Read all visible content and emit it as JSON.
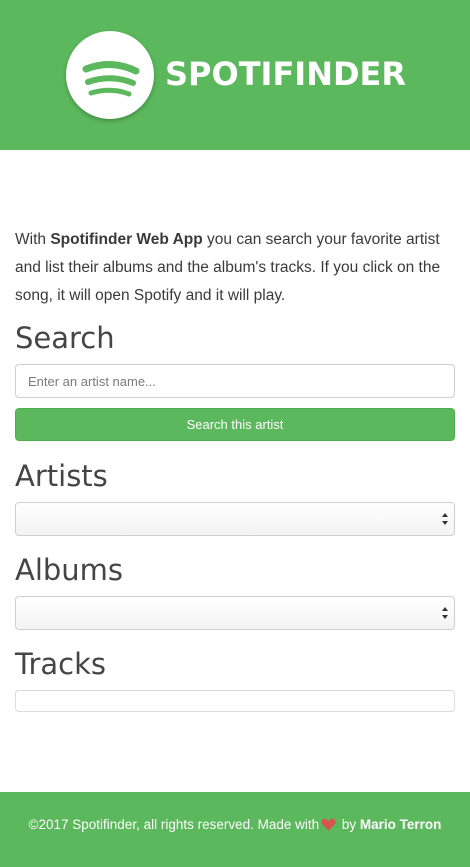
{
  "header": {
    "brand": "SPOTIFINDER",
    "logo_icon": "spotify-logo-icon",
    "background_color": "#5cb85c"
  },
  "intro": {
    "prefix": "With ",
    "app_name": "Spotifinder Web App",
    "text": " you can search your favorite artist and list their albums and the album's tracks. If you click on the song, it will open Spotify and it will play."
  },
  "search": {
    "title": "Search",
    "placeholder": "Enter an artist name...",
    "value": "",
    "button_label": "Search this artist"
  },
  "artists": {
    "title": "Artists",
    "selected": ""
  },
  "albums": {
    "title": "Albums",
    "selected": ""
  },
  "tracks": {
    "title": "Tracks",
    "items": []
  },
  "footer": {
    "text": "©2017 Spotifinder, all rights reserved. Made with",
    "heart_icon": "heart-icon",
    "by": " by ",
    "author": "Mario Terron",
    "heart_color": "#d9534f"
  }
}
